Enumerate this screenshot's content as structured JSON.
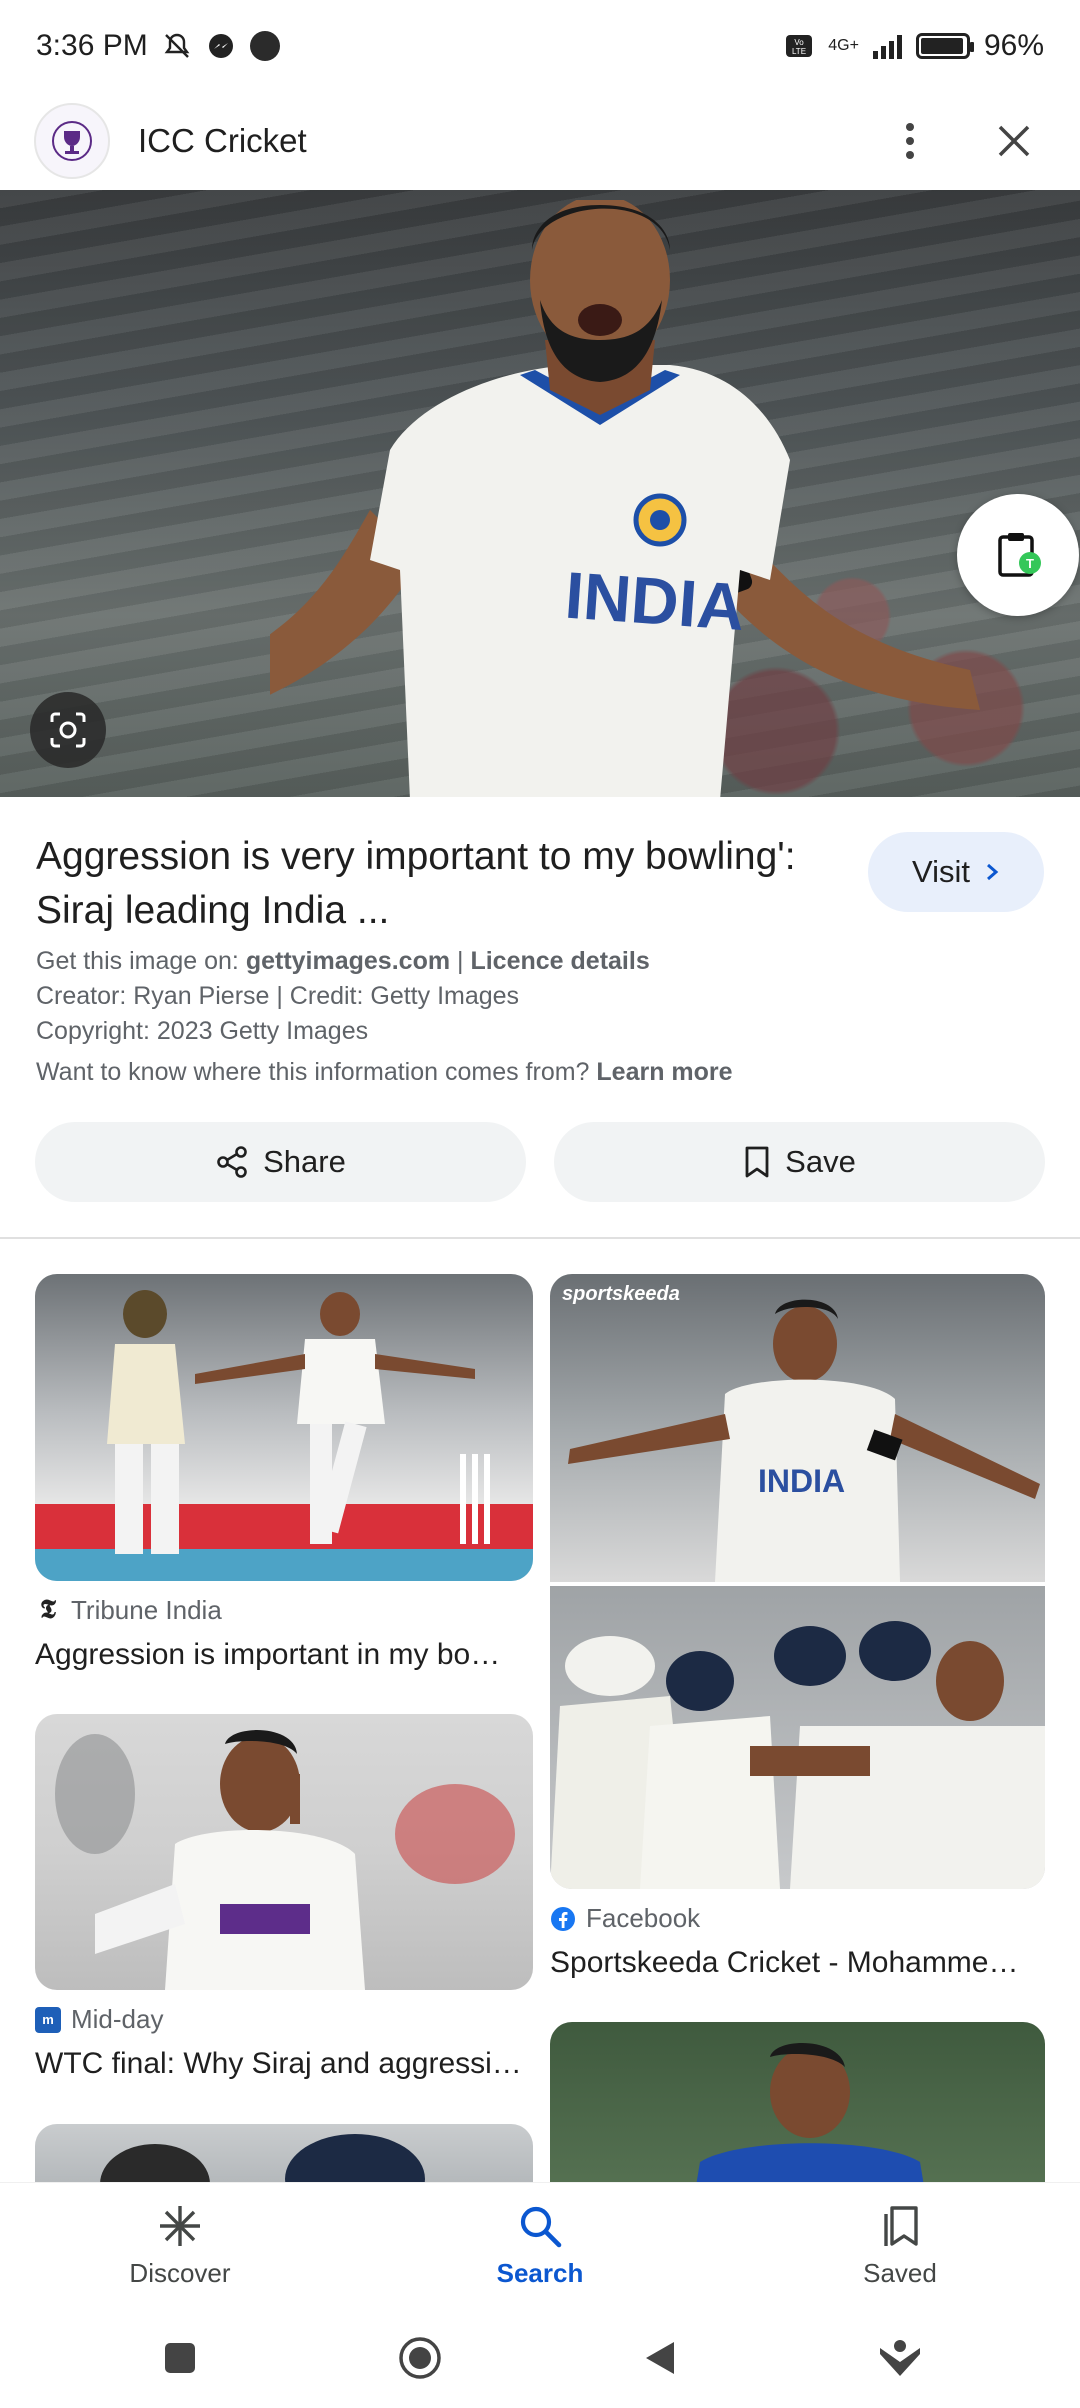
{
  "status_bar": {
    "time": "3:36 PM",
    "network": "4G+",
    "battery_percent": "96%",
    "battery_level": 0.96
  },
  "header": {
    "site_name": "ICC Cricket",
    "logo_icon": "icc-world-cup-logo-icon",
    "more_icon": "more-vert-icon",
    "close_icon": "close-icon"
  },
  "image_detail": {
    "title": "Aggression is very important to my bowling': Siraj leading India ...",
    "visit_label": "Visit",
    "get_image_prefix": "Get this image on: ",
    "get_image_source": "gettyimages.com",
    "separator": " | ",
    "licence_label": "Licence details",
    "creator_line": "Creator: Ryan Pierse | Credit: Getty Images",
    "copyright_line": "Copyright: 2023 Getty Images",
    "info_question": "Want to know where this information comes from? ",
    "learn_more": "Learn more",
    "share_label": "Share",
    "save_label": "Save"
  },
  "results": [
    {
      "source": "Tribune India",
      "title": "Aggression is important in my bo…"
    },
    {
      "source": "Facebook",
      "title": "Sportskeeda Cricket - Mohamme…"
    },
    {
      "source": "Mid-day",
      "title": "WTC final: Why Siraj and aggressi…"
    }
  ],
  "result_image_text": {
    "sportskeeda_watermark": "sportskeeda",
    "jersey_text": "INDIA"
  },
  "bottom_nav": {
    "discover": "Discover",
    "search": "Search",
    "saved": "Saved"
  },
  "colors": {
    "accent": "#0b57d0",
    "visit_bg": "#e8effb",
    "chip_bg": "#f1f3f4"
  }
}
